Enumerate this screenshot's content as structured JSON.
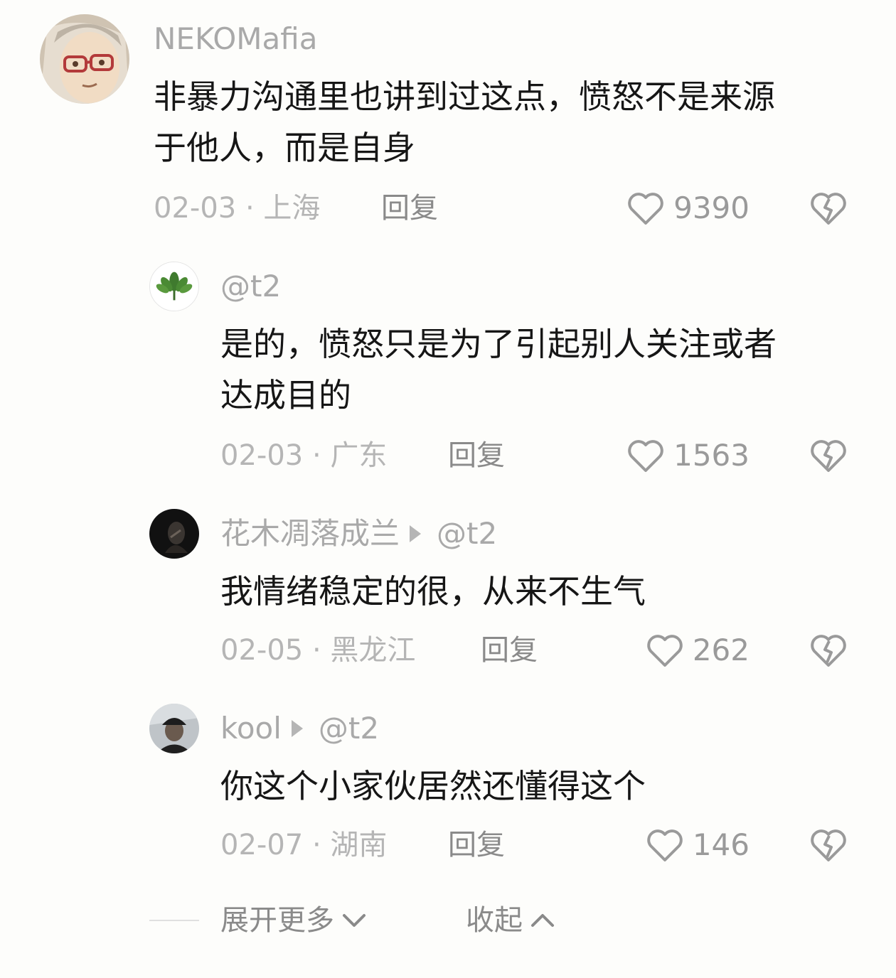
{
  "comments": [
    {
      "name": "NEKOMafia",
      "text_lines": [
        "非暴力沟通里也讲到过这点，愤怒不是来源",
        "于他人，而是自身"
      ],
      "date": "02-03",
      "location": "上海",
      "reply_label": "回复",
      "likes": "9390"
    },
    {
      "name": "@t2",
      "text_lines": [
        "是的，愤怒只是为了引起别人关注或者",
        "达成目的"
      ],
      "date": "02-03",
      "location": "广东",
      "reply_label": "回复",
      "likes": "1563"
    },
    {
      "name": "花木凋落成兰",
      "reply_to": "@t2",
      "text_lines": [
        "我情绪稳定的很，从来不生气"
      ],
      "date": "02-05",
      "location": "黑龙江",
      "reply_label": "回复",
      "likes": "262"
    },
    {
      "name": "kool",
      "reply_to": "@t2",
      "text_lines": [
        "你这个小家伙居然还懂得这个"
      ],
      "date": "02-07",
      "location": "湖南",
      "reply_label": "回复",
      "likes": "146"
    }
  ],
  "meta_separator": "·",
  "footer": {
    "expand_label": "展开更多",
    "collapse_label": "收起"
  },
  "icons": {
    "like": "heart-outline-icon",
    "dislike": "broken-heart-icon",
    "expand": "chevron-down-icon",
    "collapse": "chevron-up-icon",
    "reply_arrow": "play-triangle-icon"
  },
  "colors": {
    "background": "#fdfdfb",
    "name": "#a9a9a9",
    "text": "#161616",
    "meta": "#b5b5b5",
    "action": "#8a8a8a"
  }
}
